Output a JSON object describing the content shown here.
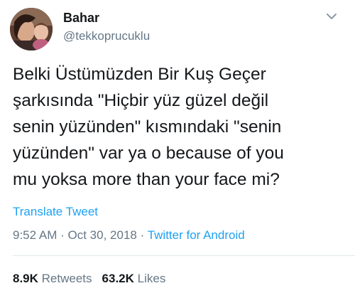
{
  "user": {
    "name": "Bahar",
    "handle": "@tekkoprucuklu"
  },
  "tweet": {
    "text": "Belki Üstümüzden Bir Kuş Geçer\nşarkısında \"Hiçbir yüz güzel değil\nsenin yüzünden\" kısmındaki \"senin\nyüzünden\" var ya o because of you\nmu yoksa more than your face mi?",
    "translate_label": "Translate Tweet",
    "time": "9:52 AM",
    "date": "Oct 30, 2018",
    "separator": "·",
    "source": "Twitter for Android"
  },
  "stats": {
    "retweets_count": "8.9K",
    "retweets_label": "Retweets",
    "likes_count": "63.2K",
    "likes_label": "Likes"
  },
  "icons": {
    "caret": "chevron-down-icon",
    "avatar": "avatar"
  },
  "colors": {
    "link": "#1da1f2",
    "secondary": "#657786",
    "primary": "#14171a",
    "divider": "#e1e8ed"
  }
}
